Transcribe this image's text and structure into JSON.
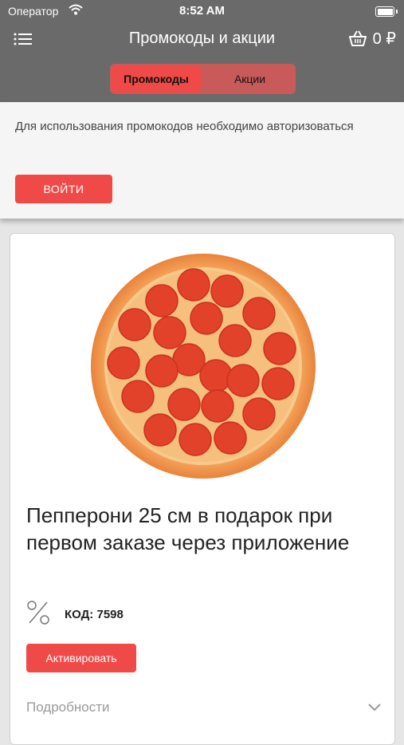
{
  "status_bar": {
    "carrier": "Оператор",
    "time": "8:52 AM"
  },
  "header": {
    "title": "Промокоды и акции",
    "cart_total": "0 ₽",
    "tabs": [
      {
        "label": "Промокоды",
        "active": true
      },
      {
        "label": "Акции",
        "active": false
      }
    ]
  },
  "auth_notice": {
    "text": "Для использования промокодов необходимо авторизоваться",
    "button_label": "ВОЙТИ"
  },
  "promo": {
    "title": "Пепперони 25 см в подарок при первом заказе через приложение",
    "code_text": "КОД: 7598",
    "activate_label": "Активировать",
    "details_label": "Подробности"
  },
  "colors": {
    "accent": "#ef4a48",
    "header": "#6a6a6a"
  }
}
